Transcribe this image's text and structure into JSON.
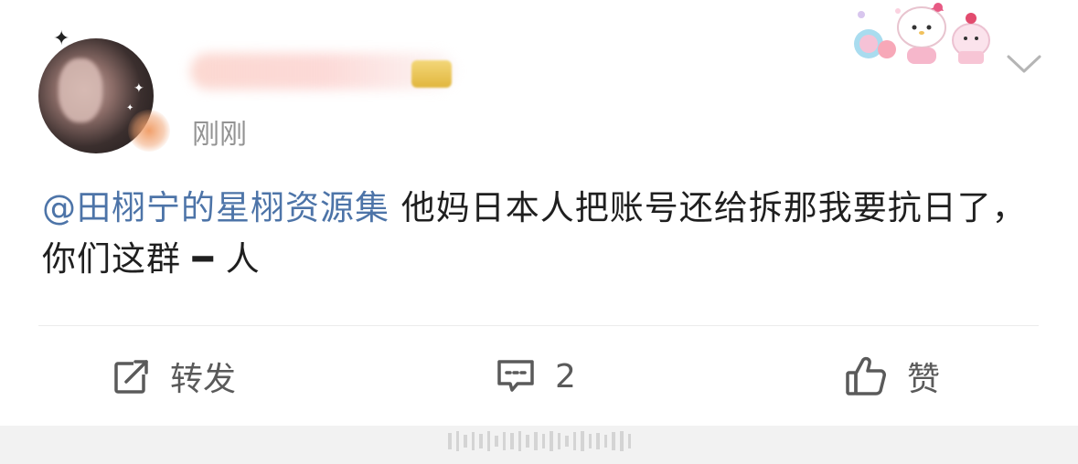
{
  "post": {
    "timestamp": "刚刚",
    "mention": "@田栩宁的星栩资源集",
    "body": " 他妈日本人把账号还给拆那我要抗日了，你们这群 ━ 人"
  },
  "actions": {
    "repost_label": "转发",
    "comment_count": "2",
    "like_label": "赞"
  },
  "icons": {
    "repost": "repost-icon",
    "comment": "comment-icon",
    "like": "thumbs-up-icon",
    "more": "chevron-down-icon"
  },
  "colors": {
    "mention": "#4d74a8",
    "text": "#1f1f1f",
    "timestamp": "#939393",
    "action": "#5a5a5a"
  }
}
